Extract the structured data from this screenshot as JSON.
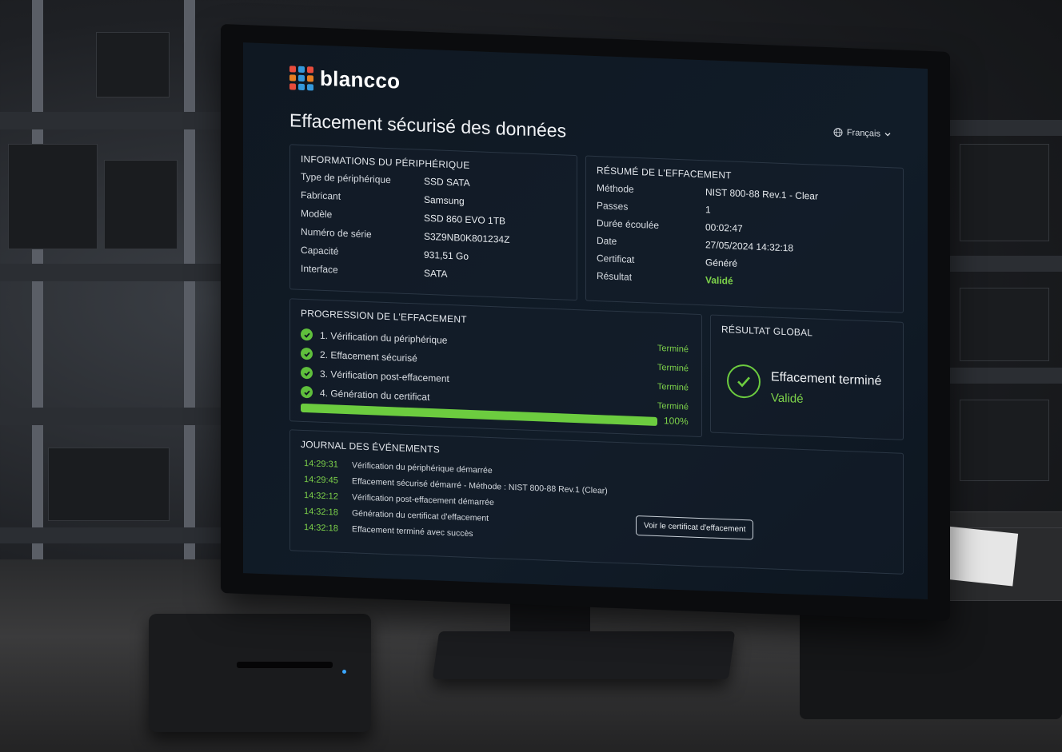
{
  "brand": "blancco",
  "page_title": "Effacement sécurisé des données",
  "language": "Français",
  "device_info": {
    "title": "INFORMATIONS DU PÉRIPHÉRIQUE",
    "rows": [
      {
        "k": "Type de périphérique",
        "v": "SSD SATA"
      },
      {
        "k": "Fabricant",
        "v": "Samsung"
      },
      {
        "k": "Modèle",
        "v": "SSD 860 EVO 1TB"
      },
      {
        "k": "Numéro de série",
        "v": "S3Z9NB0K801234Z"
      },
      {
        "k": "Capacité",
        "v": "931,51 Go"
      },
      {
        "k": "Interface",
        "v": "SATA"
      }
    ]
  },
  "summary": {
    "title": "RÉSUMÉ DE L'EFFACEMENT",
    "rows": [
      {
        "k": "Méthode",
        "v": "NIST 800-88 Rev.1 - Clear"
      },
      {
        "k": "Passes",
        "v": "1"
      },
      {
        "k": "Durée écoulée",
        "v": "00:02:47"
      },
      {
        "k": "Date",
        "v": "27/05/2024 14:32:18"
      },
      {
        "k": "Certificat",
        "v": "Généré"
      },
      {
        "k": "Résultat",
        "v": "Validé"
      }
    ]
  },
  "progress": {
    "title": "PROGRESSION DE L'EFFACEMENT",
    "steps": [
      {
        "label": "1. Vérification du périphérique",
        "status": "Terminé"
      },
      {
        "label": "2. Effacement sécurisé",
        "status": "Terminé"
      },
      {
        "label": "3. Vérification post-effacement",
        "status": "Terminé"
      },
      {
        "label": "4. Génération du certificat",
        "status": "Terminé"
      }
    ],
    "percent_label": "100%",
    "fraction": 1.0
  },
  "global_result": {
    "title": "RÉSULTAT GLOBAL",
    "headline": "Effacement terminé",
    "sub": "Validé"
  },
  "journal": {
    "title": "JOURNAL DES ÉVÉNEMENTS",
    "entries": [
      {
        "t": "14:29:31",
        "msg": "Vérification du périphérique démarrée"
      },
      {
        "t": "14:29:45",
        "msg": "Effacement sécurisé démarré - Méthode : NIST 800-88 Rev.1 (Clear)"
      },
      {
        "t": "14:32:12",
        "msg": "Vérification post-effacement démarrée"
      },
      {
        "t": "14:32:18",
        "msg": "Génération du certificat d'effacement"
      },
      {
        "t": "14:32:18",
        "msg": "Effacement terminé avec succès"
      }
    ],
    "cert_button": "Voir le certificat d'effacement"
  },
  "drive_label": "SSD",
  "colors": {
    "accent_green": "#6ccc3f",
    "background": "#0f1822"
  }
}
